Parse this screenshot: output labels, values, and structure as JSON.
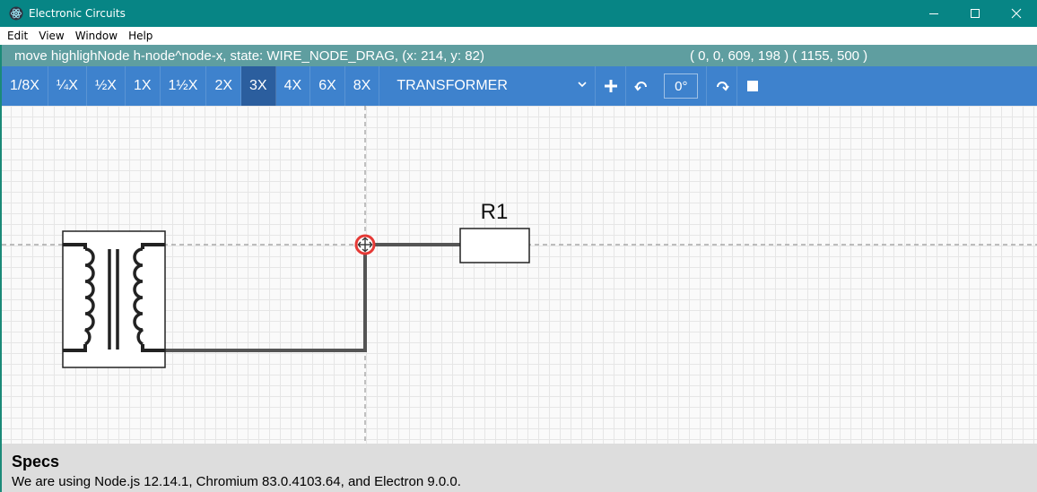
{
  "window": {
    "title": "Electronic Circuits",
    "icon": "electron-app-icon",
    "controls": [
      "minimize-icon",
      "maximize-icon",
      "close-icon"
    ]
  },
  "menu": [
    "Edit",
    "View",
    "Window",
    "Help"
  ],
  "status": {
    "left": "move highlighNode h-node^node-x, state: WIRE_NODE_DRAG, (x: 214, y: 82)",
    "right": "( 0, 0, 609, 198 )  ( 1155, 500 )"
  },
  "toolbar": {
    "zoom_levels": [
      "1/8X",
      "¼X",
      "½X",
      "1X",
      "1½X",
      "2X",
      "3X",
      "4X",
      "6X",
      "8X"
    ],
    "active_zoom": "3X",
    "component": "TRANSFORMER",
    "add_icon": "plus-icon",
    "rotate_left_icon": "rotate-left-icon",
    "angle": "0°",
    "rotate_right_icon": "rotate-right-icon",
    "stop_icon": "square-icon"
  },
  "circuit": {
    "resistor_label": "R1",
    "components": [
      "transformer",
      "resistor"
    ],
    "selected_node": "wire-node-drag"
  },
  "specs": {
    "title": "Specs",
    "text": "We are using Node.js 12.14.1, Chromium 83.0.4103.64, and Electron 9.0.0."
  },
  "colors": {
    "titlebar": "#078585",
    "statusbar": "#5f9ea0",
    "toolbar": "#3e82cd",
    "toolbar_active": "#2b5e9e",
    "node_highlight": "#e53935",
    "wire": "#555555"
  }
}
